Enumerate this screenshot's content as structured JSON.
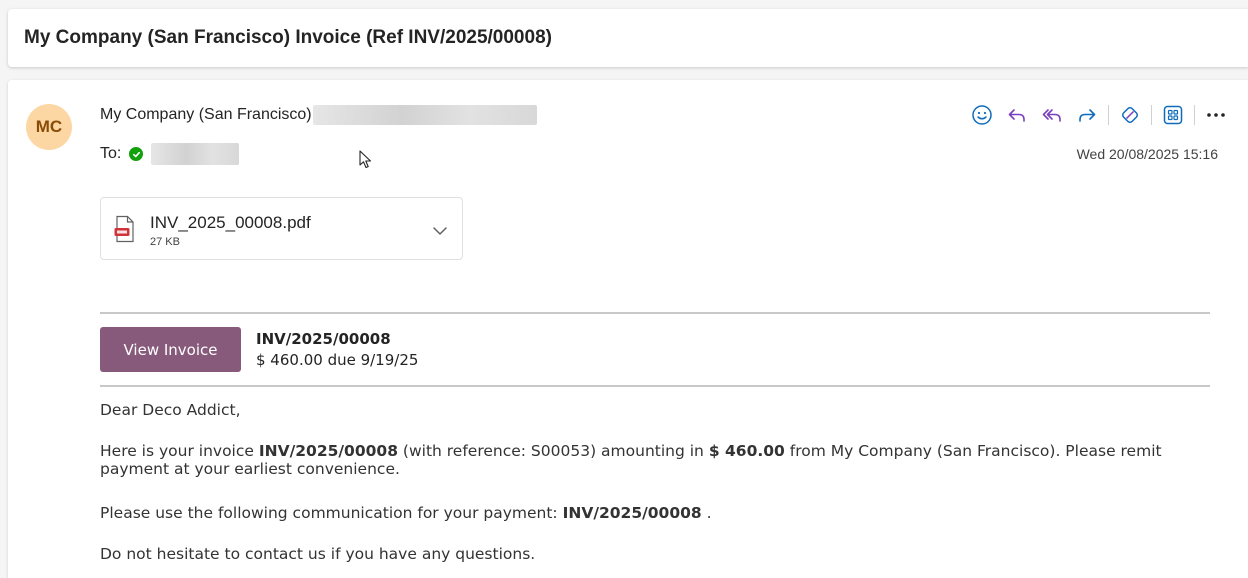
{
  "subject": "My Company (San Francisco) Invoice (Ref INV/2025/00008)",
  "message": {
    "avatar_initials": "MC",
    "from_name": "My Company (San Francisco)",
    "to_label": "To:",
    "timestamp": "Wed 20/08/2025 15:16",
    "toolbar": {
      "icons": [
        "smiley-icon",
        "reply-icon",
        "reply-all-icon",
        "forward-icon",
        "loop-icon",
        "apps-icon",
        "more-icon"
      ]
    },
    "attachment": {
      "name": "INV_2025_00008.pdf",
      "size": "27 KB"
    },
    "invoice_block": {
      "button_label": "View Invoice",
      "ref": "INV/2025/00008",
      "due": "$ 460.00 due 9/19/25"
    },
    "body": {
      "greeting": "Dear Deco Addict,",
      "p2_a": "Here is your invoice ",
      "p2_ref": "INV/2025/00008",
      "p2_b": " (with reference: S00053) amounting in ",
      "p2_amount": "$ 460.00",
      "p2_c": " from My Company (San Francisco). Please remit payment at your earliest convenience.",
      "p3_a": "Please use the following communication for your payment: ",
      "p3_ref": "INV/2025/00008",
      "p3_b": " .",
      "p4": "Do not hesitate to contact us if you have any questions."
    }
  },
  "colors": {
    "accent_purple": "#875a7b",
    "verified_green": "#13a10e",
    "avatar_bg": "#fcd7a3",
    "toolbar_blue": "#0f6cbd",
    "toolbar_purple": "#7a3fbf"
  }
}
